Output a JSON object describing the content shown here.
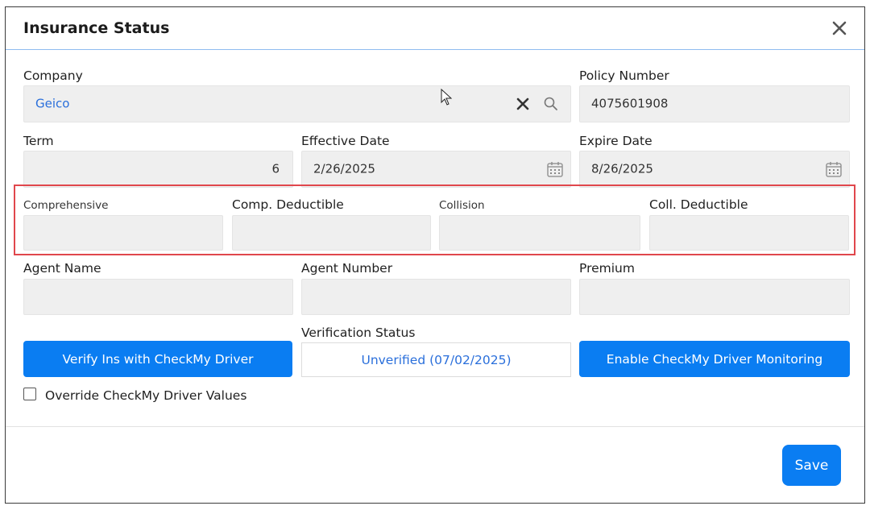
{
  "dialog": {
    "title": "Insurance Status",
    "close_icon": "close-icon"
  },
  "company": {
    "label": "Company",
    "value": "Geico"
  },
  "policy_number": {
    "label": "Policy Number",
    "value": "4075601908"
  },
  "term": {
    "label": "Term",
    "value": "6"
  },
  "effective_date": {
    "label": "Effective Date",
    "value": "2/26/2025"
  },
  "expire_date": {
    "label": "Expire Date",
    "value": "8/26/2025"
  },
  "comprehensive": {
    "label": "Comprehensive",
    "value": ""
  },
  "comp_deductible": {
    "label": "Comp. Deductible",
    "value": ""
  },
  "collision": {
    "label": "Collision",
    "value": ""
  },
  "coll_deductible": {
    "label": "Coll. Deductible",
    "value": ""
  },
  "agent_name": {
    "label": "Agent Name",
    "value": ""
  },
  "agent_number": {
    "label": "Agent Number",
    "value": ""
  },
  "premium": {
    "label": "Premium",
    "value": ""
  },
  "verification": {
    "label": "Verification Status",
    "value": "Unverified (07/02/2025)"
  },
  "buttons": {
    "verify": "Verify Ins with CheckMy Driver",
    "enable_monitoring": "Enable CheckMy Driver Monitoring",
    "save": "Save"
  },
  "override": {
    "label": "Override CheckMy Driver Values",
    "checked": false
  },
  "colors": {
    "primary": "#0a7df2",
    "link": "#2a6fdb",
    "highlight": "#e0474c"
  }
}
